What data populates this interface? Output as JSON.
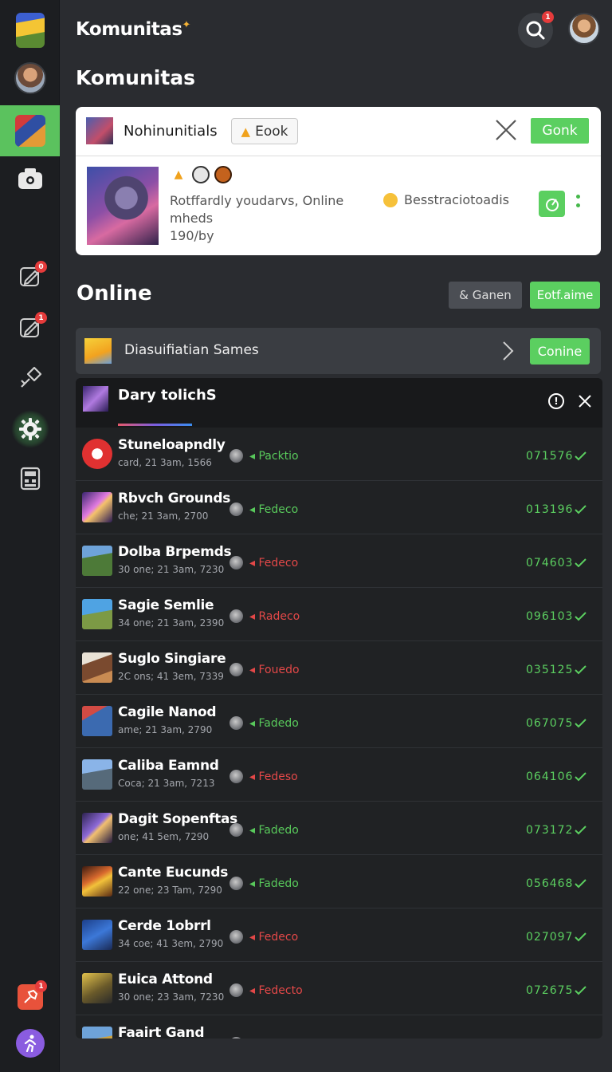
{
  "colors": {
    "accent": "#5bcf60",
    "bg": "#2a2c30",
    "sidebar": "#1c1e21",
    "badge": "#e53b3b",
    "red_status": "#e34848"
  },
  "header": {
    "title": "Komunitas",
    "search_badge": "1"
  },
  "section_title": "Komunitas",
  "sidebar": {
    "badges": [
      "0",
      "1",
      "1"
    ],
    "icons": [
      "game-logo",
      "avatar",
      "game-active",
      "camera-icon",
      "edit-icon",
      "edit-icon",
      "tool-icon",
      "gear-icon",
      "calculator-icon",
      "pin-icon",
      "run-icon"
    ]
  },
  "community_card": {
    "name": "Nohinunitials",
    "eook_label": "Eook",
    "gonk_label": "Gonk",
    "description": "Rotffardly youdarvs, Online mheds",
    "sub": "190/by",
    "mid_label": "Besstraciotoadis"
  },
  "online": {
    "title": "Online",
    "ganen_label": "& Ganen",
    "eotf_label": "Eotf.aime",
    "bar_label": "Diasuifiatian Sames",
    "conine_label": "Conine"
  },
  "panel": {
    "title": "Dary tolichS",
    "rows": [
      {
        "name": "Stuneloapndly",
        "meta": "card, 21 3am, 1566",
        "status": "Packtio",
        "status_color": "green",
        "value": "071576"
      },
      {
        "name": "Rbvch Grounds",
        "meta": "che; 21 3am, 2700",
        "status": "Fedeco",
        "status_color": "green",
        "value": "013196"
      },
      {
        "name": "Dolba Brpemds",
        "meta": "30 one; 21 3am, 7230",
        "status": "Fedeco",
        "status_color": "red",
        "value": "074603"
      },
      {
        "name": "Sagie Semlie",
        "meta": "34 one; 21 3am, 2390",
        "status": "Radeco",
        "status_color": "red",
        "value": "096103"
      },
      {
        "name": "Suglo Singiare",
        "meta": "2C ons; 41 3em, 7339",
        "status": "Fouedo",
        "status_color": "red",
        "value": "035125"
      },
      {
        "name": "Cagile Nanod",
        "meta": "ame; 21 3am, 2790",
        "status": "Fadedo",
        "status_color": "green",
        "value": "067075"
      },
      {
        "name": "Caliba Eamnd",
        "meta": "Coca; 21 3am, 7213",
        "status": "Fedeso",
        "status_color": "red",
        "value": "064106"
      },
      {
        "name": "Dagit Sopenftas",
        "meta": "one; 41 5em, 7290",
        "status": "Fadedo",
        "status_color": "green",
        "value": "073172"
      },
      {
        "name": "Cante Eucunds",
        "meta": "22 one; 23 Tam, 7290",
        "status": "Fadedo",
        "status_color": "green",
        "value": "056468"
      },
      {
        "name": "Cerde 1obrrl",
        "meta": "34 coe; 41 3em, 2790",
        "status": "Fedeco",
        "status_color": "red",
        "value": "027097"
      },
      {
        "name": "Euica Attond",
        "meta": "30 one; 23 3am, 7230",
        "status": "Fedecto",
        "status_color": "red",
        "value": "072675"
      },
      {
        "name": "Faairt Gand",
        "meta": "",
        "status": "",
        "status_color": "green",
        "value": ""
      }
    ]
  }
}
